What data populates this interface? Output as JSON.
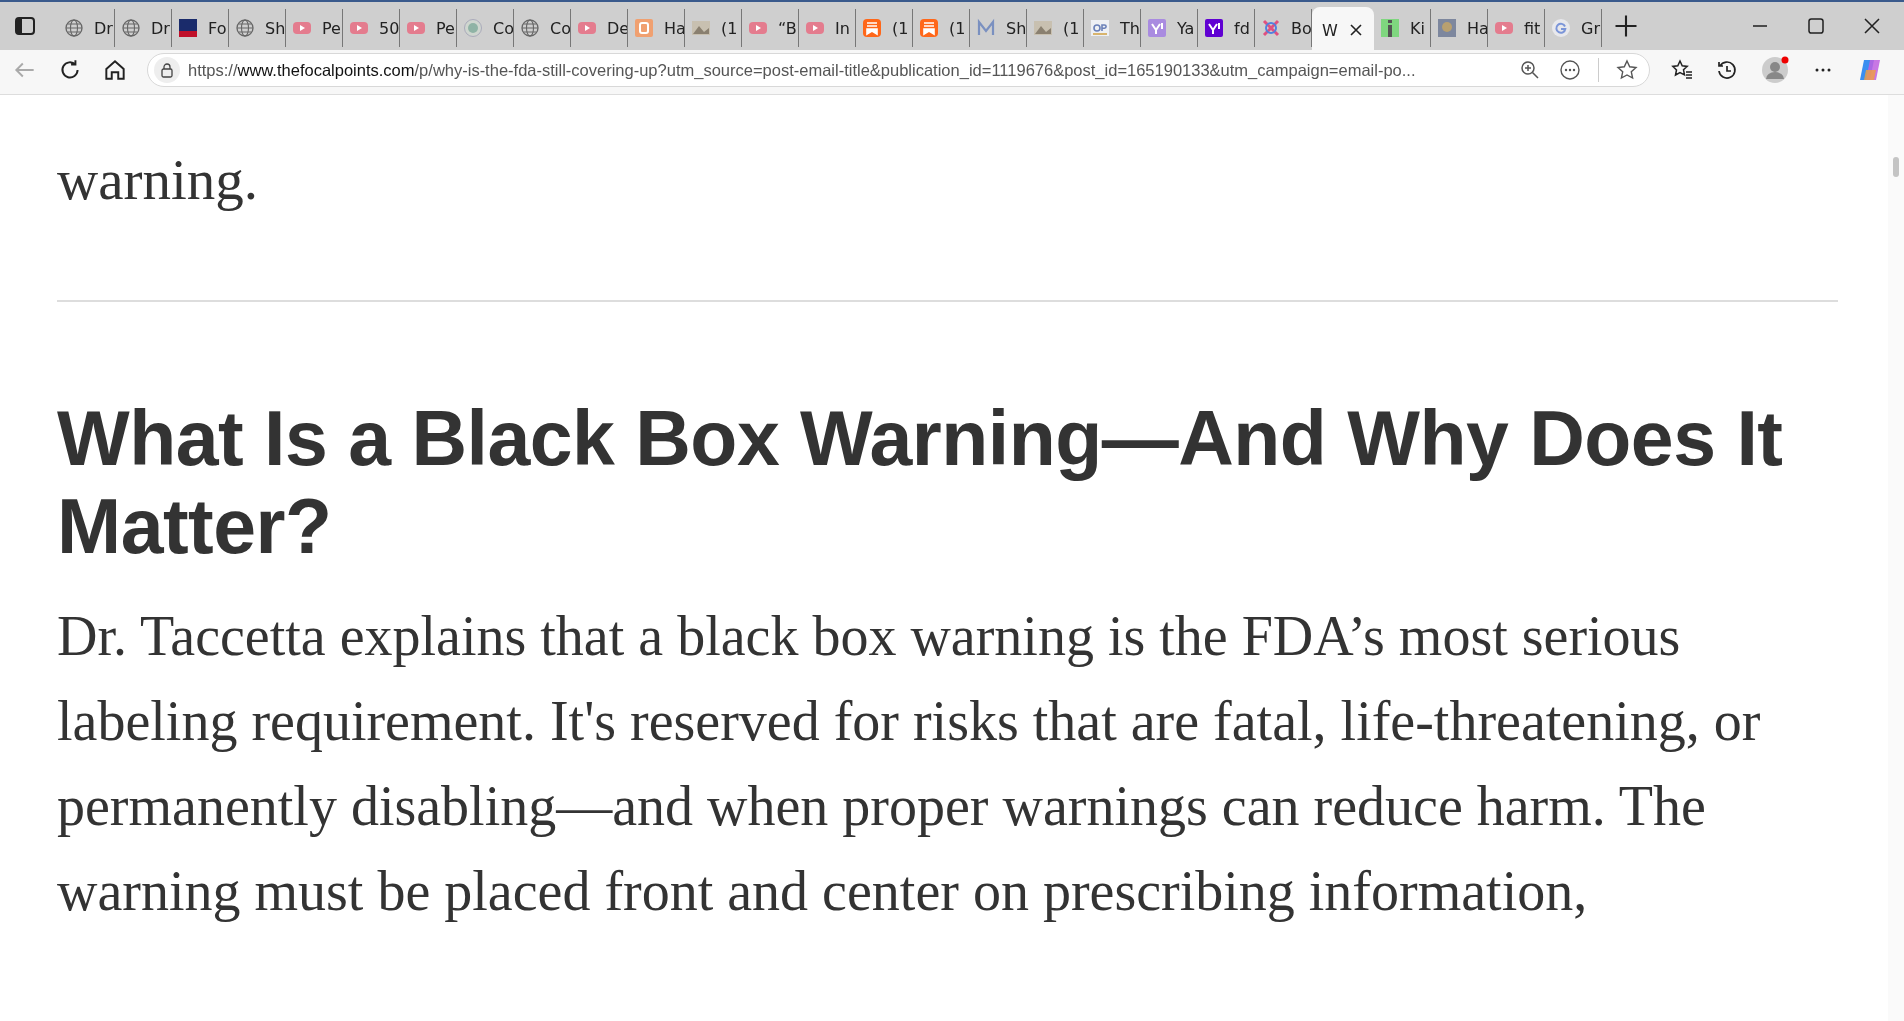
{
  "browser": {
    "tabs": [
      {
        "label": "Dr",
        "kind": "globe",
        "selected": false
      },
      {
        "label": "Dr",
        "kind": "globe",
        "selected": false
      },
      {
        "label": "Fo",
        "kind": "fox",
        "selected": false
      },
      {
        "label": "Sh",
        "kind": "globe",
        "selected": false
      },
      {
        "label": "Pe",
        "kind": "youtube",
        "selected": false
      },
      {
        "label": "50",
        "kind": "youtube",
        "selected": false
      },
      {
        "label": "Pe",
        "kind": "youtube",
        "selected": false
      },
      {
        "label": "Co",
        "kind": "seal",
        "selected": false
      },
      {
        "label": "Co",
        "kind": "globe",
        "selected": false
      },
      {
        "label": "De",
        "kind": "youtube",
        "selected": false
      },
      {
        "label": "Ha",
        "kind": "b",
        "selected": false
      },
      {
        "label": "(1",
        "kind": "photo",
        "selected": false
      },
      {
        "label": "“B",
        "kind": "youtube",
        "selected": false
      },
      {
        "label": "In",
        "kind": "youtube",
        "selected": false
      },
      {
        "label": "(1",
        "kind": "substack",
        "selected": false
      },
      {
        "label": "(1",
        "kind": "substack",
        "selected": false
      },
      {
        "label": "Sh",
        "kind": "m",
        "selected": false
      },
      {
        "label": "(1",
        "kind": "photo",
        "selected": false
      },
      {
        "label": "Th",
        "kind": "gp",
        "selected": false
      },
      {
        "label": "Ya",
        "kind": "yahoo-light",
        "selected": false
      },
      {
        "label": "fd",
        "kind": "yahoo",
        "selected": false
      },
      {
        "label": "Bo",
        "kind": "knot",
        "selected": false
      },
      {
        "label": "W",
        "kind": "none",
        "selected": true
      },
      {
        "label": "Ki",
        "kind": "green",
        "selected": false
      },
      {
        "label": "Ha",
        "kind": "lion",
        "selected": false
      },
      {
        "label": "fit",
        "kind": "youtube",
        "selected": false
      },
      {
        "label": "Gr",
        "kind": "google",
        "selected": false
      }
    ],
    "url_host_prefix": "https://",
    "url_host": "www.thefocalpoints.com",
    "url_path": "/p/why-is-the-fda-still-covering-up?utm_source=post-email-title&publication_id=1119676&post_id=165190133&utm_campaign=email-po..."
  },
  "article": {
    "lead_end": "warning.",
    "heading": "What Is a Black Box Warning—And Why Does It Matter?",
    "paragraph": "Dr. Taccetta explains that a black box warning is the FDA’s most serious labeling requirement. It's reserved for risks that are fatal, life-threatening, or permanently disabling—and when proper warnings can reduce harm. The warning must be placed front and center on prescribing information,"
  }
}
